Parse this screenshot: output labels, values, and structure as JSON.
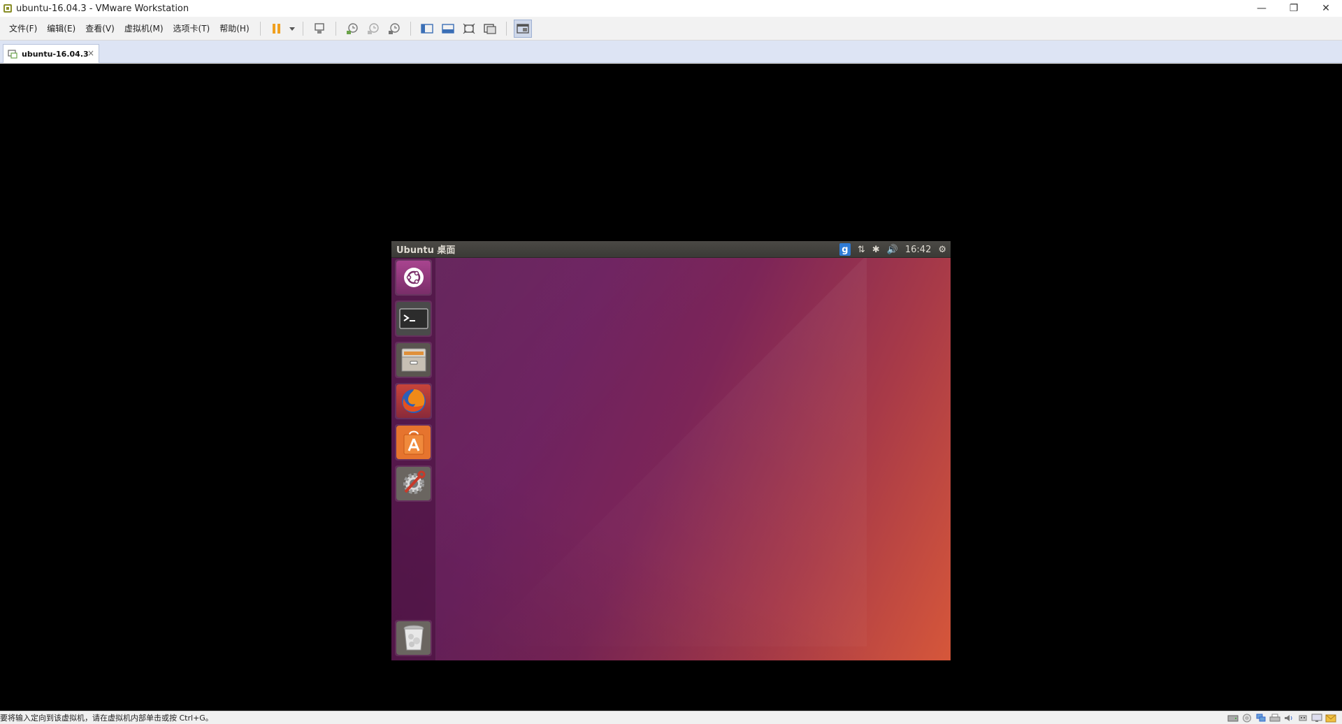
{
  "window": {
    "title": "ubuntu-16.04.3 - VMware Workstation",
    "minimize": "—",
    "restore": "❐",
    "close": "✕"
  },
  "menu": {
    "items": [
      "文件(F)",
      "编辑(E)",
      "查看(V)",
      "虚拟机(M)",
      "选项卡(T)",
      "帮助(H)"
    ]
  },
  "toolbar": {
    "icons": [
      "pause-icon",
      "dropdown-icon",
      "send-ctrl-alt-del-icon",
      "snapshot-take-icon",
      "snapshot-revert-icon",
      "snapshot-manager-icon",
      "show-library-icon",
      "thumbnail-bar-icon",
      "full-screen-icon",
      "unity-icon",
      "console-view-icon"
    ]
  },
  "tab": {
    "label": "ubuntu-16.04.3",
    "close": "×"
  },
  "ubuntu": {
    "panel_title": "Ubuntu 桌面",
    "input_indicator": "g",
    "network_indicator": "⇅",
    "bluetooth_indicator": "✱",
    "volume_indicator": "🔊",
    "clock": "16:42",
    "system_indicator": "⚙",
    "launcher_items": [
      "dash-icon",
      "terminal-icon",
      "files-icon",
      "firefox-icon",
      "software-center-icon",
      "system-settings-icon",
      "trash-icon"
    ],
    "colors": {
      "accent": "#e95420",
      "aubergine": "#77216f"
    }
  },
  "statusbar": {
    "hint": "要将输入定向到该虚拟机，请在虚拟机内部单击或按 Ctrl+G。",
    "icons": [
      "hdd-icon",
      "cd-icon",
      "network-icon",
      "printer-icon",
      "sound-icon",
      "usb-icon",
      "display-icon",
      "message-icon"
    ]
  }
}
